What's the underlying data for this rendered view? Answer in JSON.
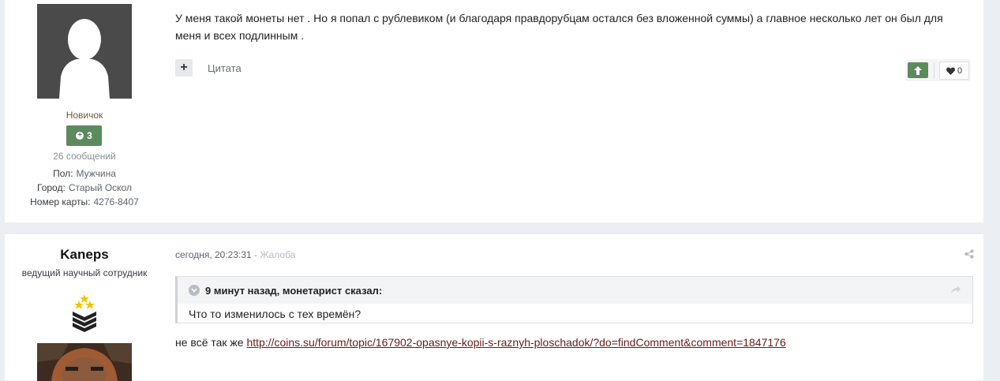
{
  "post1": {
    "author": {
      "rank": "Новичок",
      "reputation": "3",
      "message_count": "26 сообщений",
      "fields": [
        {
          "label": "Пол:",
          "value": "Мужчина"
        },
        {
          "label": "Город:",
          "value": "Старый Оскол"
        },
        {
          "label": "Номер карты:",
          "value": "4276-8407"
        }
      ]
    },
    "text": "У меня такой монеты нет . Но я попал с рублевиком (и благодаря правдорубцам остался без вложенной суммы) а главное несколько лет он был для меня и всех подлинным .",
    "quote_label": "Цитата",
    "reaction_count": "0"
  },
  "post2": {
    "author": {
      "username": "Kaneps",
      "title": "ведущий научный сотрудник"
    },
    "meta": {
      "date": "сегодня, 20:23:31",
      "separator": "-",
      "report": "Жалоба"
    },
    "quote": {
      "header": "9 минут назад, монетарист сказал:",
      "body": "Что то изменилось с тех времён?"
    },
    "text_prefix": "не всё так же",
    "link": "http://coins.su/forum/topic/167902-opasnye-kopii-s-raznyh-ploschadok/?do=findComment&comment=1847176"
  },
  "colors": {
    "background": "#ebeef2",
    "reputation_green": "#5d8a5d",
    "link": "#6b1a1a"
  },
  "icons": [
    "plus-icon",
    "arrow-up-icon",
    "heart-icon",
    "share-icon",
    "chevron-down-icon",
    "quote-arrow-icon",
    "star-icon",
    "chevron-stripes-icon"
  ]
}
